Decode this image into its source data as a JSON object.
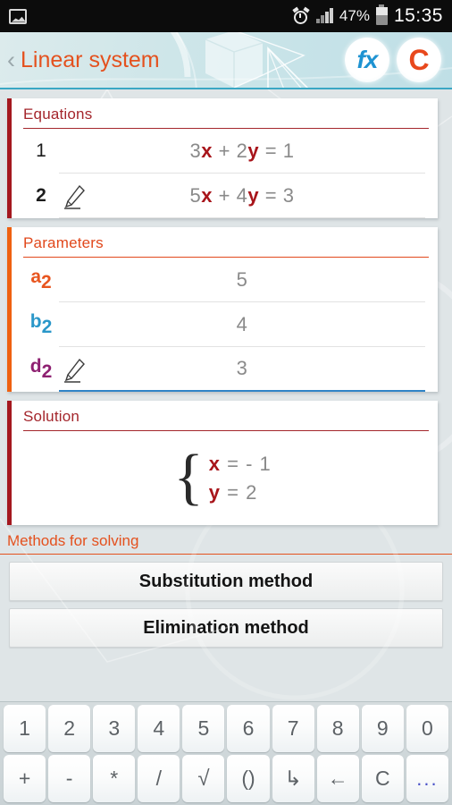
{
  "statusbar": {
    "image_icon": "image-icon",
    "alarm_icon": "alarm-clock-icon",
    "signal_icon": "signal-bars-icon",
    "battery_percent": "47%",
    "battery_icon": "battery-icon",
    "time": "15:35"
  },
  "header": {
    "back_icon": "‹",
    "title": "Linear system",
    "fx_button": "fx",
    "clear_button": "C"
  },
  "equations": {
    "title": "Equations",
    "rows": [
      {
        "index": "1",
        "coef1": "3",
        "var1": "x",
        "plus": " + ",
        "coef2": "2",
        "var2": "y",
        "eq": " = ",
        "rhs": "1",
        "editable": false
      },
      {
        "index": "2",
        "coef1": "5",
        "var1": "x",
        "plus": " + ",
        "coef2": "4",
        "var2": "y",
        "eq": " = ",
        "rhs": "3",
        "editable": true
      }
    ]
  },
  "parameters": {
    "title": "Parameters",
    "rows": [
      {
        "name": "a",
        "sub": "2",
        "value": "5",
        "active": false
      },
      {
        "name": "b",
        "sub": "2",
        "value": "4",
        "active": false
      },
      {
        "name": "d",
        "sub": "2",
        "value": "3",
        "active": true
      }
    ]
  },
  "solution": {
    "title": "Solution",
    "brace": "{",
    "lines": [
      {
        "var": "x",
        "rest": " =  - 1"
      },
      {
        "var": "y",
        "rest": " = 2"
      }
    ]
  },
  "methods": {
    "title": "Methods for solving",
    "buttons": [
      {
        "label": "Substitution method"
      },
      {
        "label": "Elimination method"
      }
    ]
  },
  "keyboard": {
    "row1": [
      "1",
      "2",
      "3",
      "4",
      "5",
      "6",
      "7",
      "8",
      "9",
      "0"
    ],
    "row2": [
      "+",
      "-",
      "*",
      "/",
      "√",
      "()",
      "↳",
      "←",
      "C",
      "..."
    ]
  },
  "colors": {
    "accent_orange": "#e4511e",
    "accent_dark_red": "#a4262c",
    "accent_blue": "#2a97c9",
    "accent_purple": "#8e2071",
    "header_border": "#3aa7c4",
    "value_gray": "#8a8a8a"
  }
}
